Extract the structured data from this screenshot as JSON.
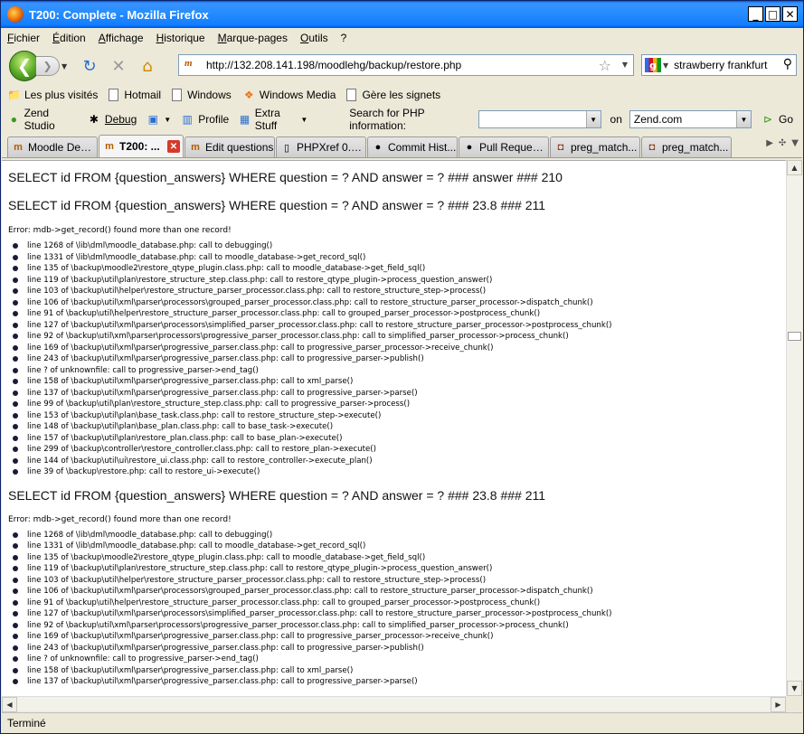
{
  "window": {
    "title": "T200: Complete - Mozilla Firefox"
  },
  "menu": [
    "Fichier",
    "Édition",
    "Affichage",
    "Historique",
    "Marque-pages",
    "Outils",
    "?"
  ],
  "nav": {
    "url": "http://132.208.141.198/moodlehg/backup/restore.php",
    "search_value": "strawberry frankfurt"
  },
  "bookmarks": [
    "Les plus visités",
    "Hotmail",
    "Windows",
    "Windows Media",
    "Gère les signets"
  ],
  "zend": {
    "items": [
      "Zend Studio",
      "Debug",
      "Profile",
      "Extra Stuff"
    ],
    "search_label": "Search for PHP information:",
    "search_value": "",
    "on_label": "on",
    "site_value": "Zend.com",
    "go_label": "Go"
  },
  "tabs": [
    "Moodle Dem...",
    "T200: ...",
    "Edit questions",
    "PHPXref 0.7...",
    "Commit Hist...",
    "Pull Request...",
    "preg_match...",
    "preg_match..."
  ],
  "content": {
    "sql1": "SELECT id FROM {question_answers} WHERE question = ? AND answer = ? ### answer ### 210",
    "sql2": "SELECT id FROM {question_answers} WHERE question = ? AND answer = ? ### 23.8 ### 211",
    "error1": "Error: mdb->get_record() found more than one record!",
    "trace1": [
      "line 1268 of \\lib\\dml\\moodle_database.php: call to debugging()",
      "line 1331 of \\lib\\dml\\moodle_database.php: call to moodle_database->get_record_sql()",
      "line 135 of \\backup\\moodle2\\restore_qtype_plugin.class.php: call to moodle_database->get_field_sql()",
      "line 119 of \\backup\\util\\plan\\restore_structure_step.class.php: call to restore_qtype_plugin->process_question_answer()",
      "line 103 of \\backup\\util\\helper\\restore_structure_parser_processor.class.php: call to restore_structure_step->process()",
      "line 106 of \\backup\\util\\xml\\parser\\processors\\grouped_parser_processor.class.php: call to restore_structure_parser_processor->dispatch_chunk()",
      "line 91 of \\backup\\util\\helper\\restore_structure_parser_processor.class.php: call to grouped_parser_processor->postprocess_chunk()",
      "line 127 of \\backup\\util\\xml\\parser\\processors\\simplified_parser_processor.class.php: call to restore_structure_parser_processor->postprocess_chunk()",
      "line 92 of \\backup\\util\\xml\\parser\\processors\\progressive_parser_processor.class.php: call to simplified_parser_processor->process_chunk()",
      "line 169 of \\backup\\util\\xml\\parser\\progressive_parser.class.php: call to progressive_parser_processor->receive_chunk()",
      "line 243 of \\backup\\util\\xml\\parser\\progressive_parser.class.php: call to progressive_parser->publish()",
      "line ? of unknownfile: call to progressive_parser->end_tag()",
      "line 158 of \\backup\\util\\xml\\parser\\progressive_parser.class.php: call to xml_parse()",
      "line 137 of \\backup\\util\\xml\\parser\\progressive_parser.class.php: call to progressive_parser->parse()",
      "line 99 of \\backup\\util\\plan\\restore_structure_step.class.php: call to progressive_parser->process()",
      "line 153 of \\backup\\util\\plan\\base_task.class.php: call to restore_structure_step->execute()",
      "line 148 of \\backup\\util\\plan\\base_plan.class.php: call to base_task->execute()",
      "line 157 of \\backup\\util\\plan\\restore_plan.class.php: call to base_plan->execute()",
      "line 299 of \\backup\\controller\\restore_controller.class.php: call to restore_plan->execute()",
      "line 144 of \\backup\\util\\ui\\restore_ui.class.php: call to restore_controller->execute_plan()",
      "line 39 of \\backup\\restore.php: call to restore_ui->execute()"
    ],
    "sql3": "SELECT id FROM {question_answers} WHERE question = ? AND answer = ? ### 23.8 ### 211",
    "error2": "Error: mdb->get_record() found more than one record!",
    "trace2": [
      "line 1268 of \\lib\\dml\\moodle_database.php: call to debugging()",
      "line 1331 of \\lib\\dml\\moodle_database.php: call to moodle_database->get_record_sql()",
      "line 135 of \\backup\\moodle2\\restore_qtype_plugin.class.php: call to moodle_database->get_field_sql()",
      "line 119 of \\backup\\util\\plan\\restore_structure_step.class.php: call to restore_qtype_plugin->process_question_answer()",
      "line 103 of \\backup\\util\\helper\\restore_structure_parser_processor.class.php: call to restore_structure_step->process()",
      "line 106 of \\backup\\util\\xml\\parser\\processors\\grouped_parser_processor.class.php: call to restore_structure_parser_processor->dispatch_chunk()",
      "line 91 of \\backup\\util\\helper\\restore_structure_parser_processor.class.php: call to grouped_parser_processor->postprocess_chunk()",
      "line 127 of \\backup\\util\\xml\\parser\\processors\\simplified_parser_processor.class.php: call to restore_structure_parser_processor->postprocess_chunk()",
      "line 92 of \\backup\\util\\xml\\parser\\processors\\progressive_parser_processor.class.php: call to simplified_parser_processor->process_chunk()",
      "line 169 of \\backup\\util\\xml\\parser\\progressive_parser.class.php: call to progressive_parser_processor->receive_chunk()",
      "line 243 of \\backup\\util\\xml\\parser\\progressive_parser.class.php: call to progressive_parser->publish()",
      "line ? of unknownfile: call to progressive_parser->end_tag()",
      "line 158 of \\backup\\util\\xml\\parser\\progressive_parser.class.php: call to xml_parse()",
      "line 137 of \\backup\\util\\xml\\parser\\progressive_parser.class.php: call to progressive_parser->parse()"
    ]
  },
  "status": "Terminé",
  "colors": {
    "titlebar": "#0058e6",
    "chrome": "#ece9d8",
    "tab_close": "#d63a2a"
  }
}
